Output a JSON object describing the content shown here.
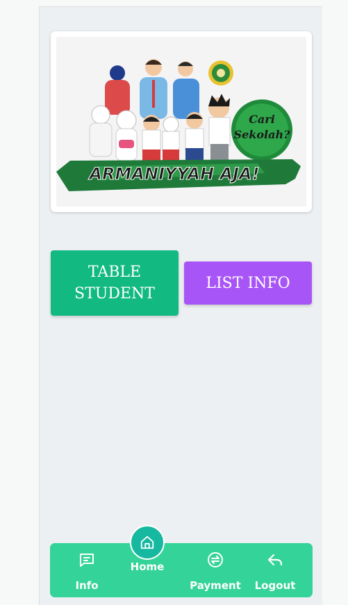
{
  "banner": {
    "alt": "Armaniyyah Aja! school banner",
    "banner_text": "ARMANIYYAH AJA!",
    "bubble_text_1": "Cari",
    "bubble_text_2": "Sekolah?"
  },
  "actions": {
    "table_student_label": "TABLE STUDENT",
    "list_info_label": "LIST INFO"
  },
  "bottom_nav": {
    "items": [
      {
        "label": "Info",
        "icon": "message-square-icon"
      },
      {
        "label": "Home",
        "icon": "home-icon",
        "active": true
      },
      {
        "label": "Payment",
        "icon": "exchange-circle-icon"
      },
      {
        "label": "Logout",
        "icon": "reply-icon"
      }
    ]
  },
  "colors": {
    "table_button": "#12b981",
    "list_button": "#a855f7",
    "nav_bar": "#34d399",
    "home_active": "#17b8a0"
  }
}
